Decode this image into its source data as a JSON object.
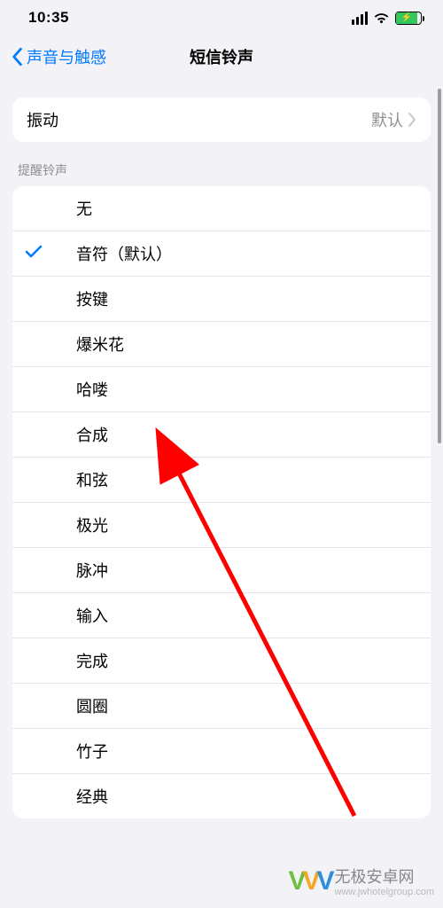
{
  "status": {
    "time": "10:35"
  },
  "nav": {
    "back_label": "声音与触感",
    "title": "短信铃声"
  },
  "vibration": {
    "label": "振动",
    "value": "默认"
  },
  "ringtones": {
    "header": "提醒铃声",
    "items": [
      {
        "label": "无",
        "selected": false
      },
      {
        "label": "音符（默认）",
        "selected": true
      },
      {
        "label": "按键",
        "selected": false
      },
      {
        "label": "爆米花",
        "selected": false
      },
      {
        "label": "哈喽",
        "selected": false
      },
      {
        "label": "合成",
        "selected": false
      },
      {
        "label": "和弦",
        "selected": false
      },
      {
        "label": "极光",
        "selected": false
      },
      {
        "label": "脉冲",
        "selected": false
      },
      {
        "label": "输入",
        "selected": false
      },
      {
        "label": "完成",
        "selected": false
      },
      {
        "label": "圆圈",
        "selected": false
      },
      {
        "label": "竹子",
        "selected": false
      },
      {
        "label": "经典",
        "selected": false
      }
    ]
  },
  "watermark": {
    "brand": "无极安卓网",
    "url": "www.jwhotelgroup.com"
  }
}
